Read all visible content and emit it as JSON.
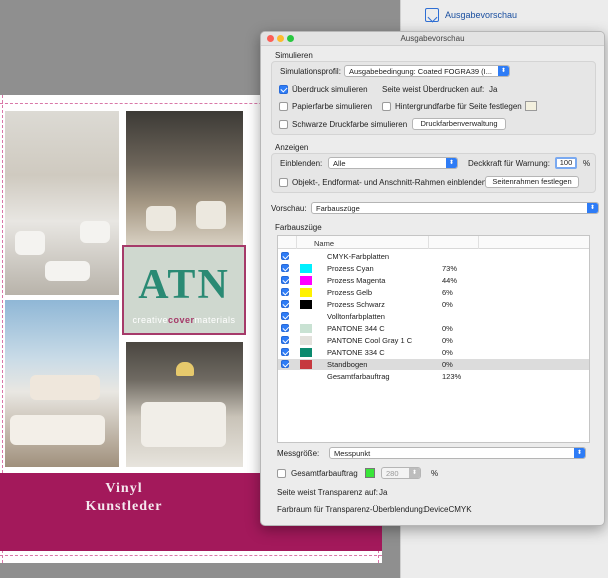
{
  "right_panel": {
    "label": "Ausgabevorschau"
  },
  "document": {
    "logo_text": "ATN",
    "logo_tag_a": "creative",
    "logo_tag_b": "cover",
    "logo_tag_c": "materials",
    "band_line1": "Vinyl",
    "band_line2": "Kunstleder",
    "band_color": "#a3195b"
  },
  "dialog": {
    "title": "Ausgabevorschau",
    "simulieren": {
      "section": "Simulieren",
      "profile_label": "Simulationsprofil:",
      "profile_value": "Ausgabebedingung: Coated FOGRA39 (I...",
      "overprint_label": "Überdruck simulieren",
      "overprint_checked": true,
      "overprint_page_label": "Seite weist Überdrucken auf:",
      "overprint_page_value": "Ja",
      "paper_label": "Papierfarbe simulieren",
      "bg_label": "Hintergrundfarbe für Seite festlegen",
      "black_label": "Schwarze Druckfarbe simulieren",
      "ink_button": "Druckfarbenverwaltung"
    },
    "anzeigen": {
      "section": "Anzeigen",
      "show_label": "Einblenden:",
      "show_value": "Alle",
      "opacity_label": "Deckkraft für Warnung:",
      "opacity_value": "100",
      "opacity_unit": "%",
      "frames_label": "Objekt-, Endformat- und Anschnitt-Rahmen einblenden",
      "frames_button": "Seitenrahmen festlegen"
    },
    "vorschau": {
      "label": "Vorschau:",
      "value": "Farbauszüge"
    },
    "farbauszuege": {
      "section": "Farbauszüge",
      "col_name": "Name",
      "rows": [
        {
          "name": "CMYK-Farbplatten",
          "pct": "",
          "color": "",
          "checked": true
        },
        {
          "name": "Prozess Cyan",
          "pct": "73%",
          "color": "#00f0ff",
          "checked": true
        },
        {
          "name": "Prozess Magenta",
          "pct": "44%",
          "color": "#ff00ff",
          "checked": true
        },
        {
          "name": "Prozess Gelb",
          "pct": "6%",
          "color": "#fff200",
          "checked": true
        },
        {
          "name": "Prozess Schwarz",
          "pct": "0%",
          "color": "#000000",
          "checked": true
        },
        {
          "name": "Volltonfarbplatten",
          "pct": "",
          "color": "",
          "checked": true
        },
        {
          "name": "PANTONE 344 C",
          "pct": "0%",
          "color": "#c9e2d3",
          "checked": true
        },
        {
          "name": "PANTONE Cool Gray 1 C",
          "pct": "0%",
          "color": "#e3e1dc",
          "checked": true
        },
        {
          "name": "PANTONE 334 C",
          "pct": "0%",
          "color": "#0b8a6e",
          "checked": true
        },
        {
          "name": "Standbogen",
          "pct": "0%",
          "color": "#c6393f",
          "checked": true,
          "selected": true
        },
        {
          "name": "Gesamtfarbauftrag",
          "pct": "123%",
          "color": "",
          "checked": false
        }
      ]
    },
    "messgroesse": {
      "label": "Messgröße:",
      "value": "Messpunkt"
    },
    "total_ink": {
      "label": "Gesamtfarbauftrag",
      "value": "280",
      "unit": "%",
      "swatch": "#39e639"
    },
    "transparency": {
      "label": "Seite weist Transparenz auf:",
      "value": "Ja"
    },
    "blend_space": {
      "label": "Farbraum für Transparenz-Überblendung:",
      "value": "DeviceCMYK"
    }
  }
}
